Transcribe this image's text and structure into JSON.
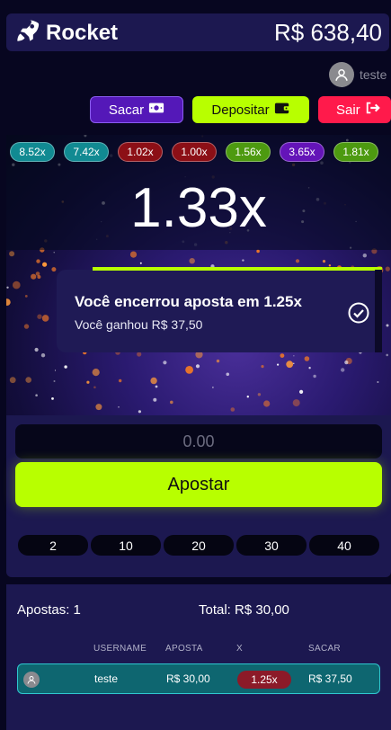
{
  "header": {
    "brand": "Rocket",
    "balance": "R$ 638,40"
  },
  "user": {
    "name": "teste"
  },
  "actions": {
    "withdraw_label": "Sacar",
    "deposit_label": "Depositar",
    "logout_label": "Sair"
  },
  "history": [
    {
      "value": "8.52x",
      "color": "#118a92"
    },
    {
      "value": "7.42x",
      "color": "#118a92"
    },
    {
      "value": "1.02x",
      "color": "#8c0f16"
    },
    {
      "value": "1.00x",
      "color": "#8c0f16"
    },
    {
      "value": "1.56x",
      "color": "#4d9a10"
    },
    {
      "value": "3.65x",
      "color": "#6414b8"
    },
    {
      "value": "1.81x",
      "color": "#4d9a10"
    }
  ],
  "game": {
    "multiplier": "1.33x"
  },
  "toast": {
    "title": "Você encerrou aposta em 1.25x",
    "subtitle": "Você ganhou R$ 37,50"
  },
  "bet": {
    "amount_placeholder": "0.00",
    "button_label": "Apostar",
    "quick_amounts": [
      "2",
      "10",
      "20",
      "30",
      "40"
    ]
  },
  "bets": {
    "count_label": "Apostas: 1",
    "total_label": "Total: R$ 30,00",
    "columns": [
      "USERNAME",
      "APOSTA",
      "X",
      "SACAR"
    ],
    "rows": [
      {
        "username": "teste",
        "aposta": "R$ 30,00",
        "x": "1.25x",
        "sacar": "R$ 37,50"
      }
    ]
  },
  "colors": {
    "accent_green": "#b8ff00",
    "panel": "#1c1850",
    "background": "#070620",
    "logout_red": "#ff1a4b",
    "withdraw_purple": "#5418b8"
  }
}
